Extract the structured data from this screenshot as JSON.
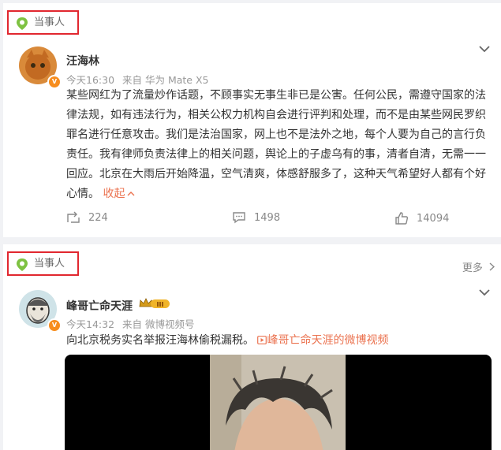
{
  "posts": [
    {
      "tag": "当事人",
      "author": "汪海林",
      "time": "今天16:30",
      "source": "来自 华为 Mate X5",
      "text": "某些网红为了流量炒作话题，不顾事实无事生非已是公害。任何公民，需遵守国家的法律法规，如有违法行为，相关公权力机构自会进行评判和处理，而不是由某些网民罗织罪名进行任意攻击。我们是法治国家，网上也不是法外之地，每个人要为自己的言行负责任。我有律师负责法律上的相关问题，舆论上的子虚乌有的事，清者自清，无需一一回应。北京在大雨后开始降温，空气清爽，体感舒服多了，这种天气希望好人都有个好心情。",
      "collapse": "收起",
      "reposts": "224",
      "comments": "1498",
      "likes": "14094"
    },
    {
      "tag": "当事人",
      "more": "更多",
      "author": "峰哥亡命天涯",
      "level": "III",
      "time": "今天14:32",
      "source": "来自 微博视频号",
      "text": "向北京税务实名举报汪海林偷税漏税。",
      "video_link": "峰哥亡命天涯的微博视频"
    }
  ],
  "colors": {
    "tag_border": "#e1272f",
    "link": "#eb7350",
    "badge": "#f78d1e"
  }
}
